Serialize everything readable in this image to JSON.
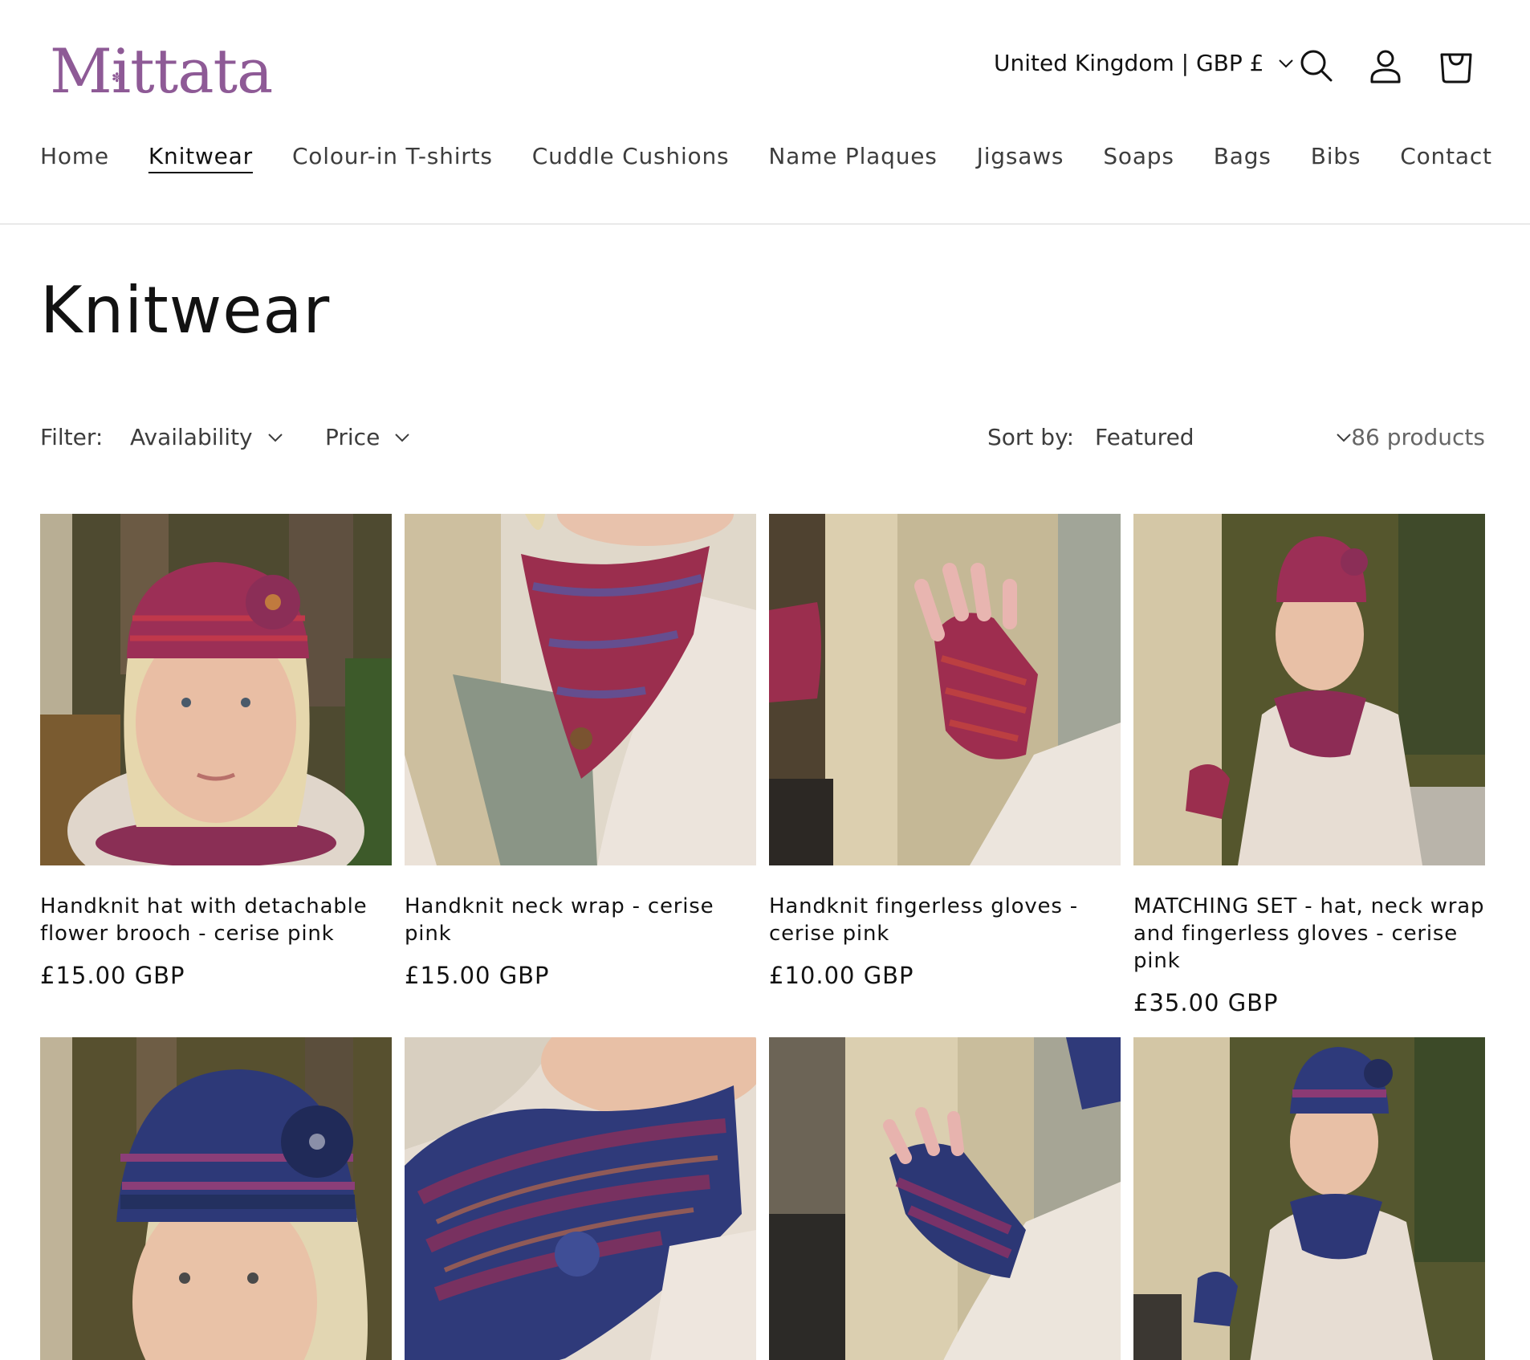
{
  "header": {
    "logo_text": "Mittata",
    "logo_color": "#8e5a96",
    "localization": "United Kingdom | GBP £",
    "icons": [
      "search-icon",
      "account-icon",
      "cart-icon"
    ]
  },
  "nav": {
    "items": [
      {
        "label": "Home"
      },
      {
        "label": "Knitwear",
        "active": true
      },
      {
        "label": "Colour-in T-shirts"
      },
      {
        "label": "Cuddle Cushions"
      },
      {
        "label": "Name Plaques"
      },
      {
        "label": "Jigsaws"
      },
      {
        "label": "Soaps"
      },
      {
        "label": "Bags"
      },
      {
        "label": "Bibs"
      },
      {
        "label": "Contact"
      }
    ]
  },
  "collection": {
    "title": "Knitwear"
  },
  "filters": {
    "label": "Filter:",
    "availability": "Availability",
    "price": "Price",
    "sort_label": "Sort by:",
    "sort_value": "Featured",
    "product_count": "86 products"
  },
  "products": [
    {
      "title": "Handknit hat with detachable flower brooch - cerise pink",
      "price": "£15.00 GBP",
      "image": "woman in cerise pink knitted hat with flower"
    },
    {
      "title": "Handknit neck wrap - cerise pink",
      "price": "£15.00 GBP",
      "image": "cerise pink neck wrap with button"
    },
    {
      "title": "Handknit fingerless gloves - cerise pink",
      "price": "£10.00 GBP",
      "image": "cerise pink fingerless gloves on pillar"
    },
    {
      "title": "MATCHING SET - hat, neck wrap and fingerless gloves - cerise pink",
      "price": "£35.00 GBP",
      "image": "woman wearing cerise pink matching set"
    },
    {
      "title": "",
      "price": "",
      "image": "woman in navy knitted hat with flower"
    },
    {
      "title": "",
      "price": "",
      "image": "navy neck wrap with button"
    },
    {
      "title": "",
      "price": "",
      "image": "navy fingerless gloves on pillar"
    },
    {
      "title": "",
      "price": "",
      "image": "woman wearing navy matching set"
    }
  ]
}
